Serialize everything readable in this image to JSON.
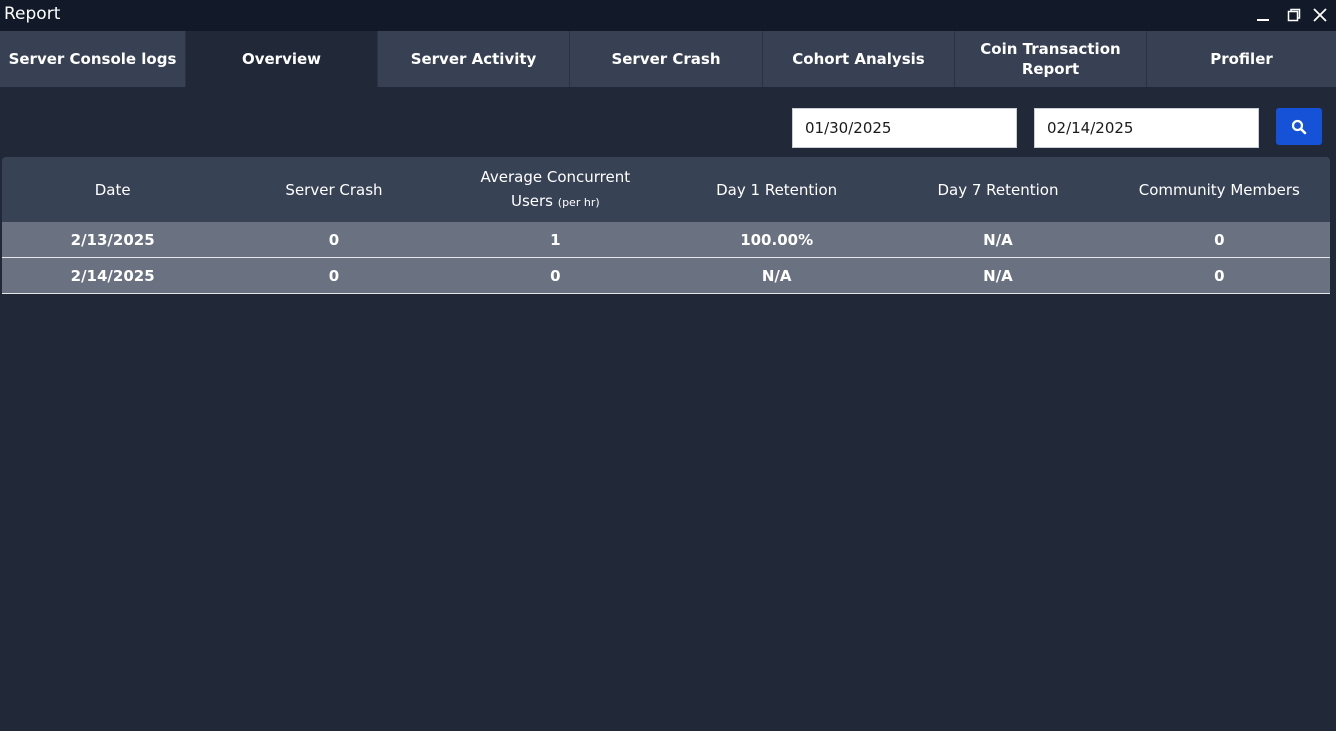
{
  "window": {
    "title": "Report"
  },
  "tabs": [
    {
      "label": "Server Console logs",
      "active": false
    },
    {
      "label": "Overview",
      "active": true
    },
    {
      "label": "Server Activity",
      "active": false
    },
    {
      "label": "Server Crash",
      "active": false
    },
    {
      "label": "Cohort Analysis",
      "active": false
    },
    {
      "label": "Coin Transaction\nReport",
      "active": false
    },
    {
      "label": "Profiler",
      "active": false
    }
  ],
  "filters": {
    "start_date": "01/30/2025",
    "end_date": "02/14/2025",
    "search_icon": "search-icon"
  },
  "table": {
    "headers": {
      "date": "Date",
      "server_crash": "Server Crash",
      "avg_users": "Average Concurrent",
      "avg_users_line2": "Users",
      "avg_users_unit": "(per hr)",
      "day1": "Day 1 Retention",
      "day7": "Day 7 Retention",
      "community": "Community Members"
    },
    "rows": [
      {
        "date": "2/13/2025",
        "server_crash": "0",
        "avg_users": "1",
        "day1": "100.00%",
        "day7": "N/A",
        "community": "0"
      },
      {
        "date": "2/14/2025",
        "server_crash": "0",
        "avg_users": "0",
        "day1": "N/A",
        "day7": "N/A",
        "community": "0"
      }
    ]
  },
  "colors": {
    "background": "#212938",
    "titlebar": "#121a2a",
    "tab": "#374153",
    "header_row": "#384255",
    "data_row": "#6a7281",
    "accent": "#1552d8"
  }
}
